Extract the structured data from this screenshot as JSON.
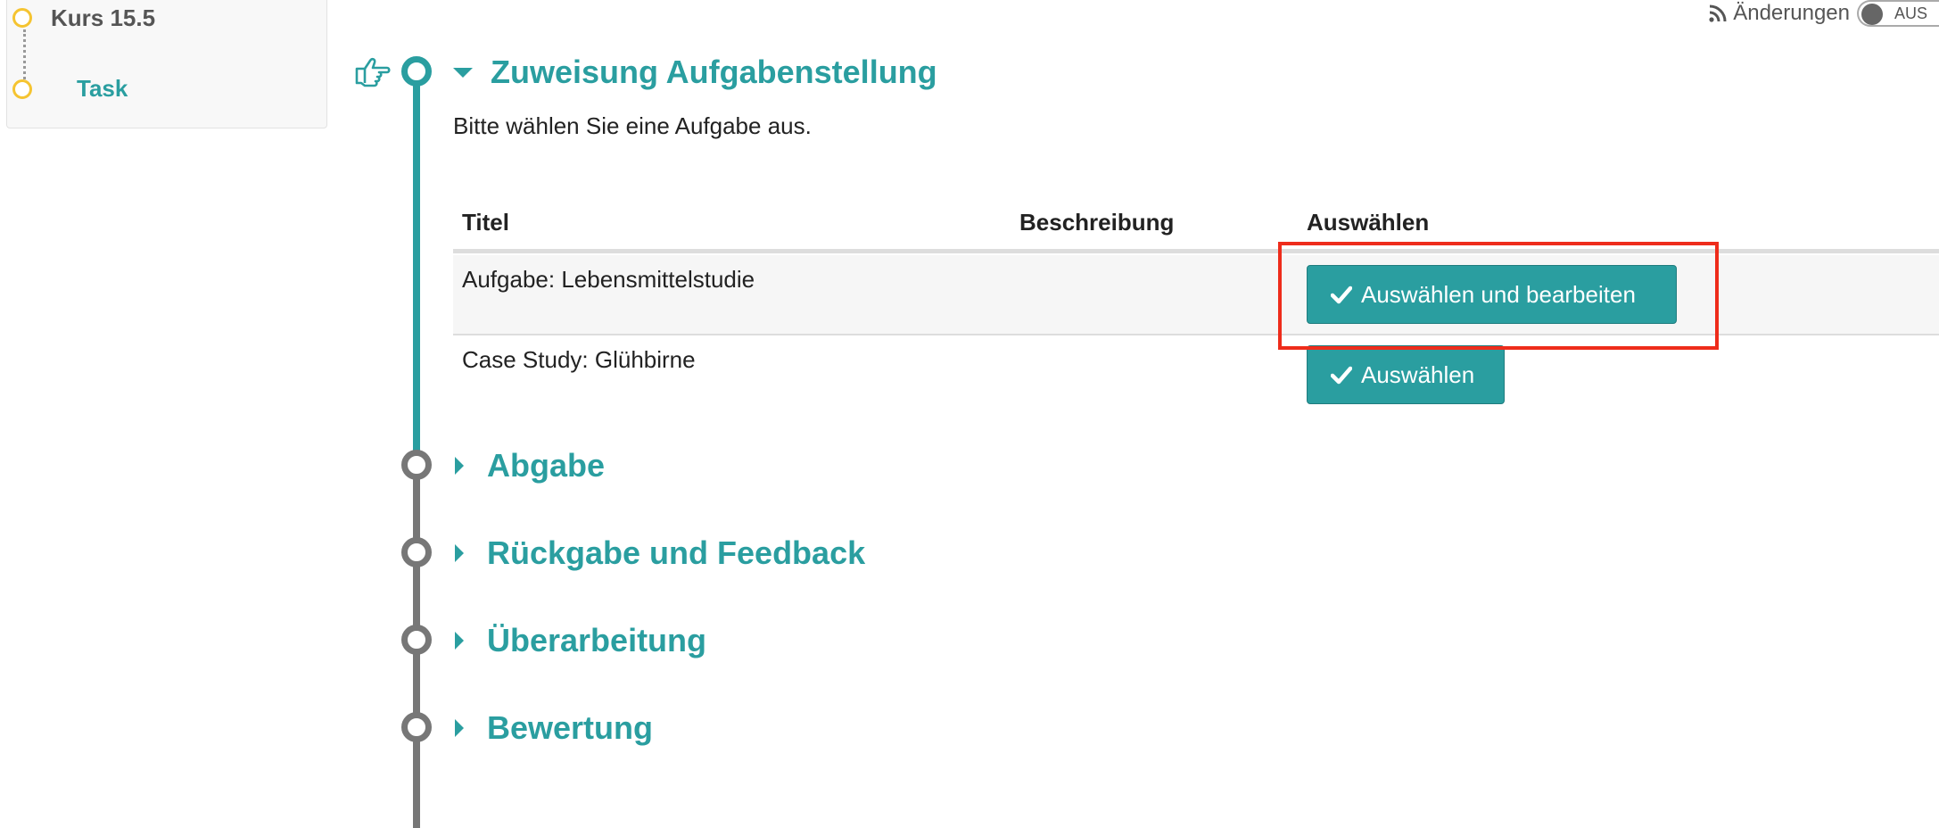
{
  "course_menu": {
    "title": "Kurs 15.5",
    "task": "Task"
  },
  "changes": {
    "icon": "rss-icon",
    "label": "Änderungen",
    "toggle_state": "AUS"
  },
  "steps": [
    {
      "title": "Zuweisung Aufgabenstellung",
      "expanded": true,
      "instruction": "Bitte wählen Sie eine Aufgabe aus.",
      "table": {
        "headers": [
          "Titel",
          "Beschreibung",
          "Auswählen"
        ],
        "rows": [
          {
            "title": "Aufgabe: Lebensmittelstudie",
            "description": "",
            "action": "Auswählen und bearbeiten"
          },
          {
            "title": "Case Study: Glühbirne",
            "description": "",
            "action": "Auswählen"
          }
        ]
      }
    },
    {
      "title": "Abgabe",
      "expanded": false
    },
    {
      "title": "Rückgabe und Feedback",
      "expanded": false
    },
    {
      "title": "Überarbeitung",
      "expanded": false
    },
    {
      "title": "Bewertung",
      "expanded": false
    }
  ],
  "colors": {
    "accent": "#2a9ea0",
    "menu_node": "#f5c431",
    "highlight": "#ee2c1b",
    "inactive_line": "#777777"
  }
}
